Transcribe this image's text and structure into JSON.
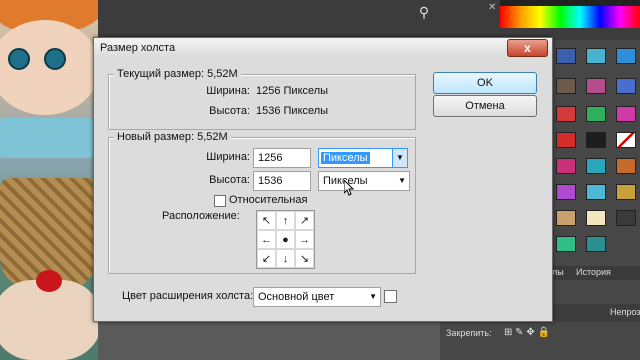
{
  "dialog": {
    "title": "Размер холста",
    "close_symbol": "x",
    "current": {
      "legend": "Текущий размер: 5,52M",
      "width_label": "Ширина:",
      "width_value": "1256 Пикселы",
      "height_label": "Высота:",
      "height_value": "1536 Пикселы"
    },
    "new_size": {
      "legend": "Новый размер: 5,52M",
      "width_label": "Ширина:",
      "width_value": "1256",
      "width_unit": "Пикселы",
      "height_label": "Высота:",
      "height_value": "1536",
      "height_unit": "Пикселы",
      "relative_label": "Относительная",
      "relative_checked": false,
      "anchor_label": "Расположение:"
    },
    "extension": {
      "label": "Цвет расширения холста:",
      "value": "Основной цвет"
    },
    "ok_label": "OK",
    "cancel_label": "Отмена"
  },
  "panels": {
    "history_tab_left": "лы",
    "history_tab_right": "История",
    "layers_lock_label": "Закрепить:",
    "opacity_label": "Непроз"
  }
}
